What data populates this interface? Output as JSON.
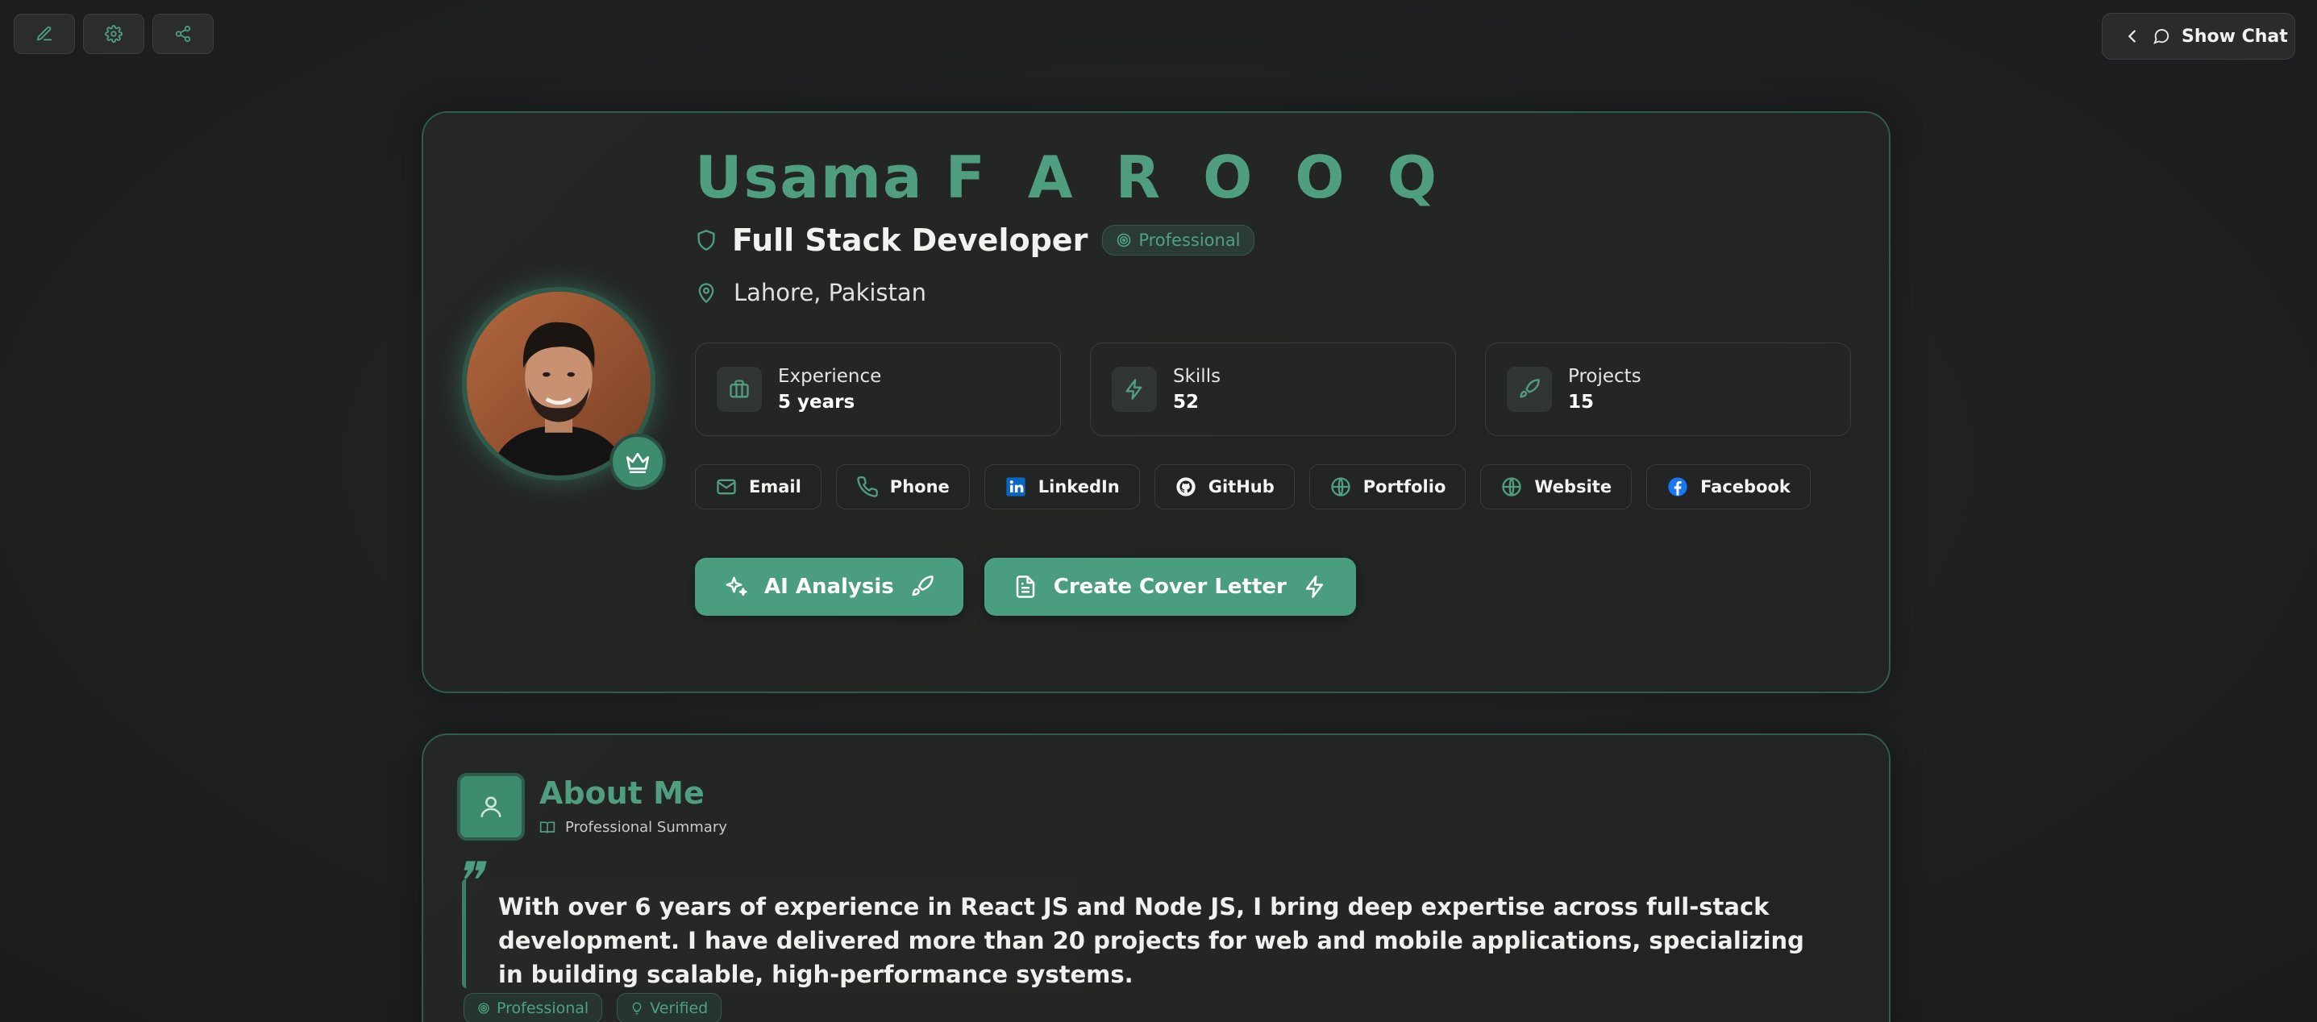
{
  "colors": {
    "accent": "#4f9e80",
    "accent_button": "#4a9d7e",
    "background": "#1e1f20",
    "card_border": "#2f5c4c"
  },
  "toolbar": {
    "buttons": [
      {
        "name": "edit",
        "icon": "edit-icon"
      },
      {
        "name": "settings",
        "icon": "gear-icon"
      },
      {
        "name": "share",
        "icon": "share-icon"
      }
    ]
  },
  "chat": {
    "label": "Show Chat",
    "icons": [
      "chevron-left-icon",
      "chat-bubble-icon"
    ]
  },
  "profile": {
    "first_name": "Usama",
    "last_name": "F A R O O Q",
    "role": "Full Stack Developer",
    "role_badge": "Professional",
    "location": "Lahore, Pakistan",
    "avatar_icon": "profile-photo",
    "badge_icon": "crown-icon",
    "stats": [
      {
        "label": "Experience",
        "value": "5 years",
        "icon": "briefcase-icon"
      },
      {
        "label": "Skills",
        "value": "52",
        "icon": "lightning-icon"
      },
      {
        "label": "Projects",
        "value": "15",
        "icon": "rocket-icon"
      }
    ],
    "contacts": [
      {
        "label": "Email",
        "icon": "mail-icon"
      },
      {
        "label": "Phone",
        "icon": "phone-icon"
      },
      {
        "label": "LinkedIn",
        "icon": "linkedin-icon"
      },
      {
        "label": "GitHub",
        "icon": "github-icon"
      },
      {
        "label": "Portfolio",
        "icon": "globe-icon"
      },
      {
        "label": "Website",
        "icon": "globe-icon"
      },
      {
        "label": "Facebook",
        "icon": "facebook-icon"
      }
    ],
    "actions": [
      {
        "label": "AI Analysis",
        "icon": "sparkle-icon",
        "trailing_icon": "rocket-icon"
      },
      {
        "label": "Create Cover Letter",
        "icon": "document-icon",
        "trailing_icon": "lightning-icon"
      }
    ]
  },
  "about": {
    "title": "About Me",
    "subtitle": "Professional Summary",
    "summary": "With over 6 years of experience in React JS and Node JS, I bring deep expertise across full-stack development. I have delivered more than 20 projects for web and mobile applications, specializing in building scalable, high-performance systems.",
    "tags": [
      {
        "label": "Professional",
        "icon": "target-icon"
      },
      {
        "label": "Verified",
        "icon": "lightbulb-icon"
      }
    ]
  }
}
